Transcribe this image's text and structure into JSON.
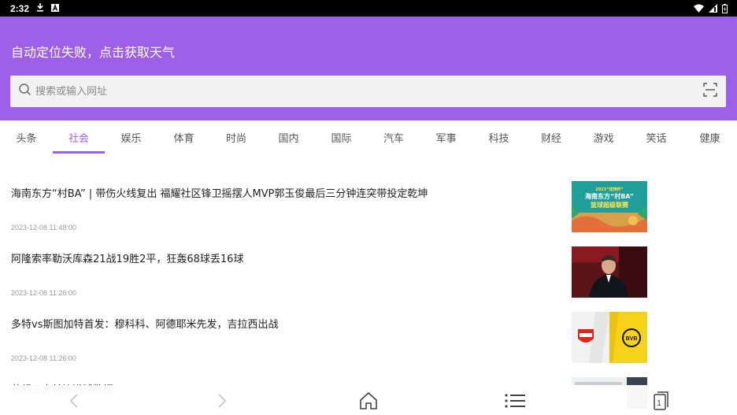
{
  "status_bar": {
    "time": "2:32",
    "icons": [
      "download-icon",
      "a-badge-icon",
      "wifi-icon",
      "signal-icon",
      "battery-icon"
    ]
  },
  "header": {
    "weather_text": "自动定位失败，点击获取天气",
    "background_color": "#9d5fe6"
  },
  "search": {
    "placeholder": "搜索或输入网址"
  },
  "tabs": [
    {
      "label": "头条",
      "active": false
    },
    {
      "label": "社会",
      "active": true
    },
    {
      "label": "娱乐",
      "active": false
    },
    {
      "label": "体育",
      "active": false
    },
    {
      "label": "时尚",
      "active": false
    },
    {
      "label": "国内",
      "active": false
    },
    {
      "label": "国际",
      "active": false
    },
    {
      "label": "汽车",
      "active": false
    },
    {
      "label": "军事",
      "active": false
    },
    {
      "label": "科技",
      "active": false
    },
    {
      "label": "财经",
      "active": false
    },
    {
      "label": "游戏",
      "active": false
    },
    {
      "label": "笑话",
      "active": false
    },
    {
      "label": "健康",
      "active": false
    }
  ],
  "news": [
    {
      "title": "海南东方“村BA” | 带伤火线复出 福耀社区锋卫摇摆人MVP郭玉俊最后三分钟连突带投定乾坤",
      "time": "2023-12-08 11:48:00",
      "thumb_text_1": "2023“炫特杯”",
      "thumb_text_2": "海南东方“村BA”",
      "thumb_text_3": "篮球超级联赛"
    },
    {
      "title": "阿隆索率勒沃库森21战19胜2平，狂轰68球丢16球",
      "time": "2023-12-08 11:26:00"
    },
    {
      "title": "多特vs斯图加特首发：穆科科、阿德耶米先发，吉拉西出战",
      "time": "2023-12-08 11:26:00",
      "thumb_text_1": "BVB"
    },
    {
      "title": "英超五大前锋进球数据",
      "time": ""
    }
  ],
  "bottom_nav": {
    "tab_count": "1"
  },
  "colors": {
    "accent": "#9d5fe6"
  }
}
